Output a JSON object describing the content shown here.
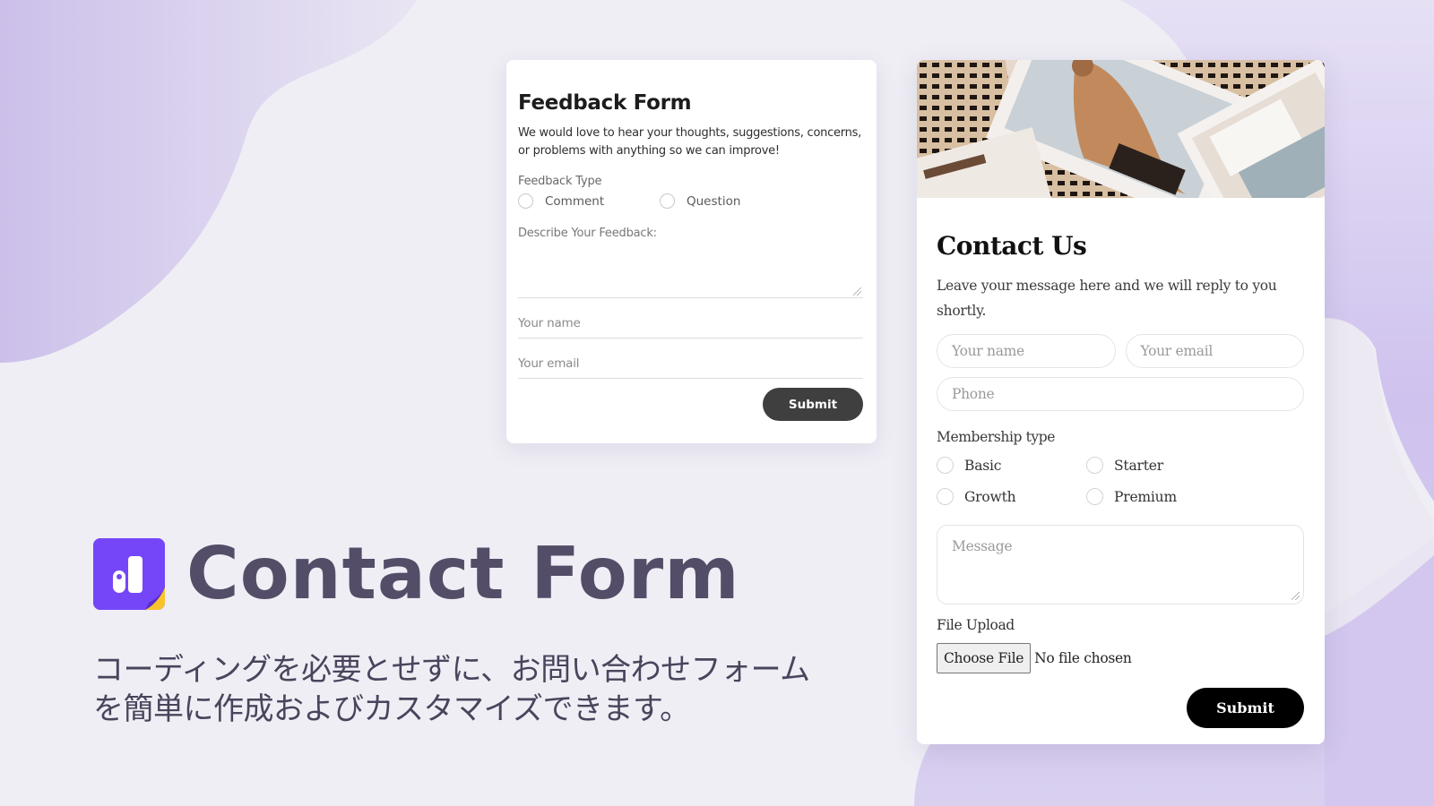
{
  "colors": {
    "background": "#efeef5",
    "blob_lavender": "#cfc3ec",
    "brand_purple": "#7546f8",
    "brand_yellow": "#f7c52b",
    "title_text": "#544d68",
    "feedback_submit_bg": "#3f3f3f",
    "contact_submit_bg": "#000000"
  },
  "feedback_form": {
    "title": "Feedback Form",
    "description": "We would love to hear your thoughts, suggestions, concerns, or problems with anything so we can improve!",
    "type_label": "Feedback Type",
    "type_options": [
      {
        "label": "Comment",
        "selected": false
      },
      {
        "label": "Question",
        "selected": false
      }
    ],
    "textarea_label": "Describe Your Feedback:",
    "name_placeholder": "Your name",
    "email_placeholder": "Your email",
    "submit_label": "Submit"
  },
  "contact_form": {
    "hero_image_icon": "photo-collage-image",
    "title": "Contact Us",
    "description": "Leave your message here and we will reply to you shortly.",
    "name_placeholder": "Your name",
    "email_placeholder": "Your email",
    "phone_placeholder": "Phone",
    "membership_label": "Membership type",
    "membership_options": [
      {
        "label": "Basic",
        "selected": false
      },
      {
        "label": "Starter",
        "selected": false
      },
      {
        "label": "Growth",
        "selected": false
      },
      {
        "label": "Premium",
        "selected": false
      }
    ],
    "message_placeholder": "Message",
    "file_upload_label": "File Upload",
    "choose_file_label": "Choose File",
    "file_status": "No file chosen",
    "submit_label": "Submit"
  },
  "branding": {
    "logo_icon": "app-logo-icon",
    "title": "Contact Form",
    "tagline_line1": "コーディングを必要とせずに、お問い合わせフォーム",
    "tagline_line2": "を簡単に作成およびカスタマイズできます。"
  }
}
